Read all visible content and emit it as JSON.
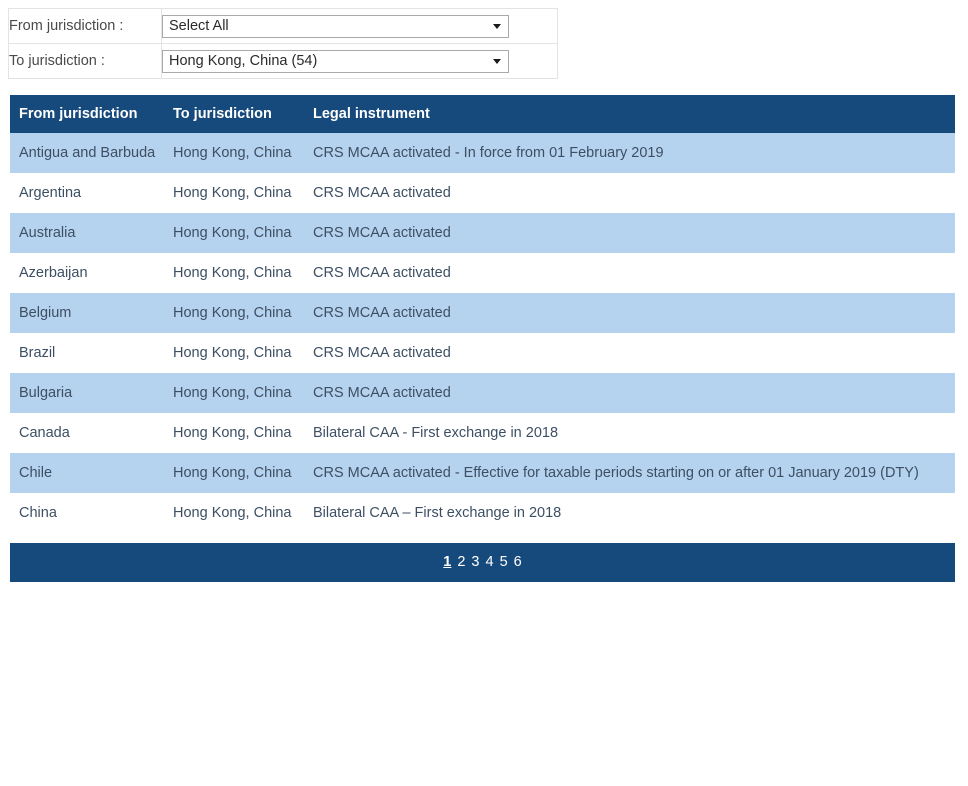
{
  "filters": [
    {
      "label": "From jurisdiction :",
      "value": "Select All",
      "name": "from-jurisdiction"
    },
    {
      "label": "To jurisdiction :",
      "value": "Hong Kong, China (54)",
      "name": "to-jurisdiction"
    }
  ],
  "table": {
    "columns": [
      "From jurisdiction",
      "To jurisdiction",
      "Legal instrument"
    ],
    "rows": [
      [
        "Antigua and Barbuda",
        "Hong Kong, China",
        "CRS MCAA activated - In force from 01 February 2019"
      ],
      [
        "Argentina",
        "Hong Kong, China",
        "CRS MCAA activated"
      ],
      [
        "Australia",
        "Hong Kong, China",
        "CRS MCAA activated"
      ],
      [
        "Azerbaijan",
        "Hong Kong, China",
        "CRS MCAA activated"
      ],
      [
        "Belgium",
        "Hong Kong, China",
        "CRS MCAA activated"
      ],
      [
        "Brazil",
        "Hong Kong, China",
        "CRS MCAA activated"
      ],
      [
        "Bulgaria",
        "Hong Kong, China",
        "CRS MCAA activated"
      ],
      [
        "Canada",
        "Hong Kong, China",
        "Bilateral CAA - First exchange in 2018"
      ],
      [
        "Chile",
        "Hong Kong, China",
        "CRS MCAA activated - Effective for taxable periods starting on or after 01 January 2019 (DTY)"
      ],
      [
        "China",
        "Hong Kong, China",
        "Bilateral CAA – First exchange in 2018"
      ]
    ]
  },
  "pager": {
    "pages": [
      "1",
      "2",
      "3",
      "4",
      "5",
      "6"
    ],
    "current": "1"
  },
  "colors": {
    "header_bar": "#174a7c",
    "row_stripe": "#b5d2ef",
    "row_plain": "#ffffff",
    "cell_text": "#3d4f63"
  },
  "icons": {
    "select_arrow": "chevron-down-icon"
  }
}
